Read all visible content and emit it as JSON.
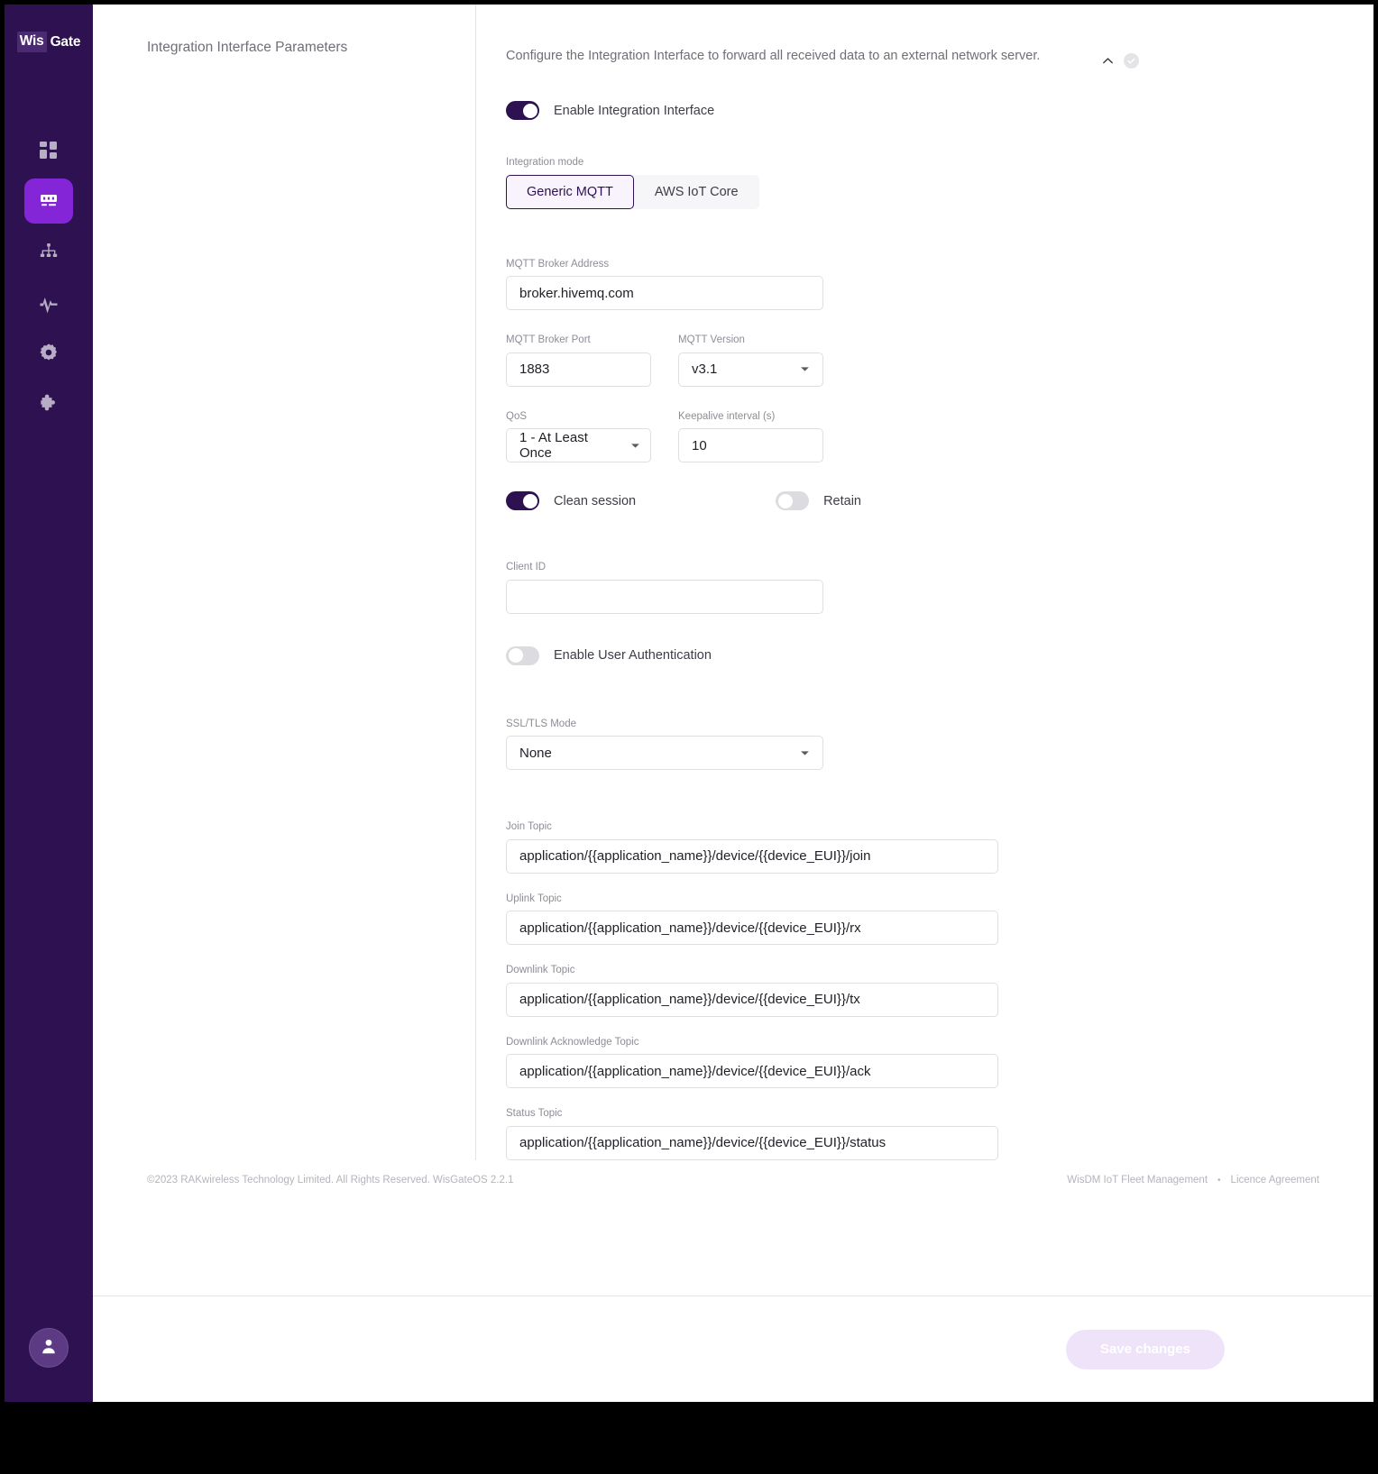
{
  "brand": {
    "logo_part1": "Wis",
    "logo_part2": "Gate"
  },
  "sidebar": {
    "items": [
      {
        "icon": "dashboard-grid-icon",
        "name": "dashboard",
        "active": false
      },
      {
        "icon": "gateway-icon",
        "name": "gateway",
        "active": true
      },
      {
        "icon": "network-hierarchy-icon",
        "name": "network",
        "active": false
      },
      {
        "icon": "activity-pulse-icon",
        "name": "activity",
        "active": false
      },
      {
        "icon": "gear-icon",
        "name": "settings",
        "active": false
      },
      {
        "icon": "puzzle-piece-icon",
        "name": "plugins",
        "active": false
      }
    ],
    "avatar_icon": "user-avatar-icon"
  },
  "page": {
    "title": "Integration Interface Parameters"
  },
  "panel": {
    "description": "Configure the Integration Interface to forward all received data to an external network server.",
    "collapse_icon": "chevron-up-icon",
    "status_icon": "check-circle-icon",
    "enable_toggle": {
      "label": "Enable Integration Interface",
      "on": true
    },
    "integration_mode": {
      "label": "Integration mode",
      "options": [
        "Generic MQTT",
        "AWS IoT Core"
      ],
      "selected": "Generic MQTT"
    },
    "broker_address": {
      "label": "MQTT Broker Address",
      "value": "broker.hivemq.com"
    },
    "broker_port": {
      "label": "MQTT Broker Port",
      "value": "1883"
    },
    "mqtt_version": {
      "label": "MQTT Version",
      "value": "v3.1"
    },
    "qos": {
      "label": "QoS",
      "value": "1 - At Least Once"
    },
    "keepalive": {
      "label": "Keepalive interval (s)",
      "value": "10"
    },
    "clean_session": {
      "label": "Clean session",
      "on": true
    },
    "retain": {
      "label": "Retain",
      "on": false
    },
    "client_id": {
      "label": "Client ID",
      "value": ""
    },
    "user_auth": {
      "label": "Enable User Authentication",
      "on": false
    },
    "ssl_tls": {
      "label": "SSL/TLS Mode",
      "value": "None"
    },
    "topics": [
      {
        "label": "Join Topic",
        "value": "application/{{application_name}}/device/{{device_EUI}}/join"
      },
      {
        "label": "Uplink Topic",
        "value": "application/{{application_name}}/device/{{device_EUI}}/rx"
      },
      {
        "label": "Downlink Topic",
        "value": "application/{{application_name}}/device/{{device_EUI}}/tx"
      },
      {
        "label": "Downlink Acknowledge Topic",
        "value": "application/{{application_name}}/device/{{device_EUI}}/ack"
      },
      {
        "label": "Status Topic",
        "value": "application/{{application_name}}/device/{{device_EUI}}/status"
      }
    ]
  },
  "footer": {
    "copyright": "©2023 RAKwireless Technology Limited. All Rights Reserved. WisGateOS 2.2.1",
    "link_fleet": "WisDM IoT Fleet Management",
    "separator": "•",
    "link_licence": "Licence Agreement"
  },
  "action_bar": {
    "save_label": "Save changes"
  },
  "colors": {
    "sidebar_bg": "#2d1150",
    "accent": "#8425d8",
    "toggle_on": "#2d1150",
    "save_disabled": "#efe3fa"
  }
}
